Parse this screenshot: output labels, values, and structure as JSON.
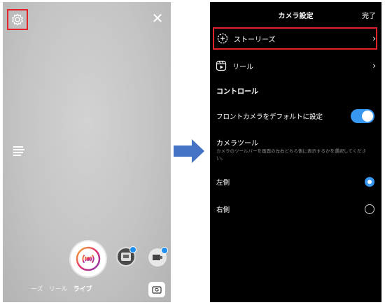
{
  "left": {
    "mode_tabs": [
      "ーズ",
      "リール",
      "ライブ"
    ],
    "active_mode": "ライブ",
    "icons": {
      "settings": "gear-icon",
      "close": "close-icon",
      "menu": "menu-lines-icon",
      "shutter": "live-shutter-icon",
      "flip": "camera-flip-icon"
    },
    "close_glyph": "✕",
    "highlight_color": "#e3232c"
  },
  "right": {
    "title": "カメラ設定",
    "done": "完了",
    "stories_label": "ストーリーズ",
    "reels_label": "リール",
    "chevron": "›",
    "section_controls": "コントロール",
    "front_camera_label": "フロントカメラをデフォルトに設定",
    "front_camera_on": true,
    "camera_tools_title": "カメラツール",
    "camera_tools_desc": "カメラのツールバーを画面の左右どちら側に表示するかを選択してください。",
    "side_left": "左側",
    "side_right": "右側",
    "selected_side": "左側",
    "accent_color": "#3897f0"
  },
  "arrow_color": "#4472c4"
}
